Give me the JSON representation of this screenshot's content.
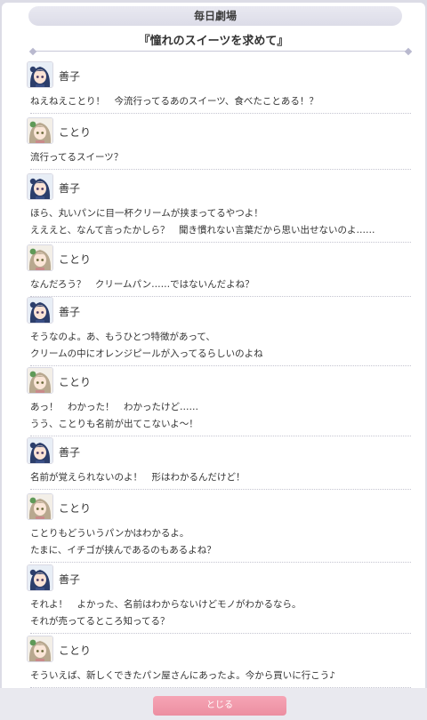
{
  "header": {
    "title": "毎日劇場"
  },
  "story": {
    "title": "『憧れのスイーツを求めて』"
  },
  "dialogue": [
    {
      "speaker": "善子",
      "avatar": "yoshiko-avatar",
      "lines": [
        "ねえねえことり！　今流行ってるあのスイーツ、食べたことある！？"
      ]
    },
    {
      "speaker": "ことり",
      "avatar": "kotori-avatar",
      "lines": [
        "流行ってるスイーツ？"
      ]
    },
    {
      "speaker": "善子",
      "avatar": "yoshiko-avatar",
      "lines": [
        "ほら、丸いパンに目一杯クリームが挟まってるやつよ！",
        "えええと、なんて言ったかしら？　聞き慣れない言葉だから思い出せないのよ……"
      ]
    },
    {
      "speaker": "ことり",
      "avatar": "kotori-avatar",
      "lines": [
        "なんだろう？　クリームパン……ではないんだよね？"
      ]
    },
    {
      "speaker": "善子",
      "avatar": "yoshiko-avatar",
      "lines": [
        "そうなのよ。あ、もうひとつ特徴があって、",
        "クリームの中にオレンジピールが入ってるらしいのよね"
      ]
    },
    {
      "speaker": "ことり",
      "avatar": "kotori-avatar",
      "lines": [
        "あっ！　わかった！　わかったけど……",
        "うう、ことりも名前が出てこないよ～！"
      ]
    },
    {
      "speaker": "善子",
      "avatar": "yoshiko-avatar",
      "lines": [
        "名前が覚えられないのよ！　形はわかるんだけど！"
      ]
    },
    {
      "speaker": "ことり",
      "avatar": "kotori-avatar",
      "lines": [
        "ことりもどういうパンかはわかるよ。",
        "たまに、イチゴが挟んであるのもあるよね？"
      ]
    },
    {
      "speaker": "善子",
      "avatar": "yoshiko-avatar",
      "lines": [
        "それよ！　よかった、名前はわからないけどモノがわかるなら。",
        "それが売ってるところ知ってる？"
      ]
    },
    {
      "speaker": "ことり",
      "avatar": "kotori-avatar",
      "lines": [
        "そういえば、新しくできたパン屋さんにあったよ。今から買いに行こう♪"
      ]
    }
  ],
  "footer": {
    "close_label": "とじる"
  },
  "colors": {
    "close_button": "#f09aab",
    "header_bg": "#e3e3ec",
    "yoshiko_hair": "#2c3e6b",
    "kotori_hair": "#b8a88f"
  }
}
